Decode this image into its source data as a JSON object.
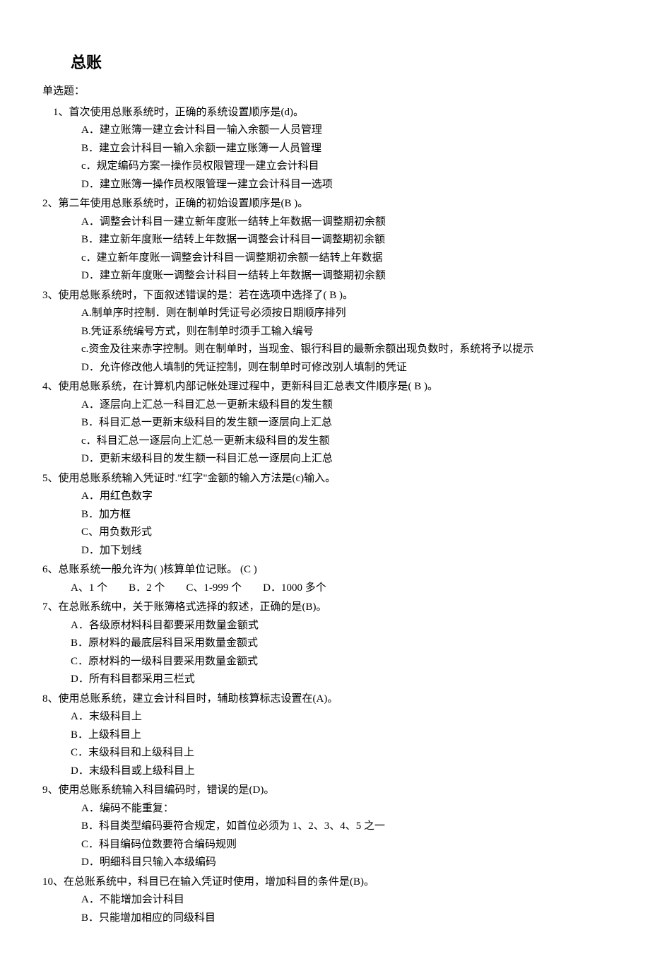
{
  "title": "总账",
  "section_label": "单选题：",
  "questions": [
    {
      "stem": "1、首次使用总账系统时，正确的系统设置顺序是(d)。",
      "stem_indent": true,
      "options": [
        "A．建立账簿一建立会计科目一输入余额一人员管理",
        "B．建立会计科目一输入余额一建立账簿一人员管理",
        "c．规定编码方案一操作员权限管理一建立会计科目",
        "D．建立账簿一操作员权限管理一建立会计科目一选项"
      ]
    },
    {
      "stem": "2、第二年使用总账系统时，正确的初始设置顺序是(B  )。",
      "options": [
        "A．调整会计科目一建立新年度账一结转上年数据一调整期初余额",
        "B．建立新年度账一结转上年数据一调整会计科目一调整期初余额",
        "c．建立新年度账一调整会计科目一调整期初余额一结转上年数据",
        "D．建立新年度账一调整会计科目一结转上年数据一调整期初余额"
      ]
    },
    {
      "stem": "3、使用总账系统时，下面叙述错误的是：若在选项中选择了(  B  )。",
      "options": [
        "A.制单序时控制．则在制单时凭证号必须按日期顺序排列",
        "B.凭证系统编号方式，则在制单时须手工输入编号",
        "c.资金及往来赤字控制。则在制单时，当现金、银行科目的最新余额出现负数时，系统将予以提示",
        "D．允许修改他人填制的凭证控制，则在制单时可修改别人填制的凭证"
      ]
    },
    {
      "stem": "4、使用总账系统，在计算机内部记帐处理过程中，更新科目汇总表文件顺序是(  B  )。",
      "options": [
        "A．逐层向上汇总一科目汇总一更新末级科目的发生额",
        "B．科目汇总一更新末级科目的发生额一逐层向上汇总",
        "c．科目汇总一逐层向上汇总一更新末级科目的发生额",
        "D．更新末级科目的发生额一科目汇总一逐层向上汇总"
      ]
    },
    {
      "stem": "5、使用总账系统输入凭证时.\"红字\"金额的输入方法是(c)输入。",
      "options": [
        "A．用红色数字",
        "B．加方框",
        "C、用负数形式",
        "D．加下划线"
      ]
    },
    {
      "stem": "6、总账系统一般允许为(    )核算单位记账。    (C )",
      "inline_options": [
        "A、1 个",
        "B．2 个",
        "C、1-999 个",
        "D．1000 多个"
      ]
    },
    {
      "stem": "7、在总账系统中，关于账簿格式选择的叙述，正确的是(B)。",
      "options_indent2": true,
      "options": [
        "A．各级原材料科目都要采用数量金额式",
        "B．原材料的最底层科目采用数量金额式",
        "C．原材料的一级科目要采用数量金额式",
        "D．所有科目都采用三栏式"
      ]
    },
    {
      "stem": "8、使用总账系统，建立会计科目时，辅助核算标志设置在(A)。",
      "options_indent2": true,
      "options": [
        "A．末级科目上",
        "B．上级科目上",
        "C．末级科目和上级科目上",
        "D．末级科目或上级科目上"
      ]
    },
    {
      "stem": "9、使用总账系统输入科目编码时，错误的是(D)。",
      "options": [
        "A．编码不能重复：",
        "B．科目类型编码要符合规定，如首位必须为 1、2、3、4、5 之一",
        "C．科目编码位数要符合编码规则",
        "D．明细科目只输入本级编码"
      ]
    },
    {
      "stem": "10、在总账系统中，科目已在输入凭证时使用，增加科目的条件是(B)。",
      "options": [
        "A．不能增加会计科目",
        "B．只能增加相应的同级科目"
      ]
    }
  ]
}
